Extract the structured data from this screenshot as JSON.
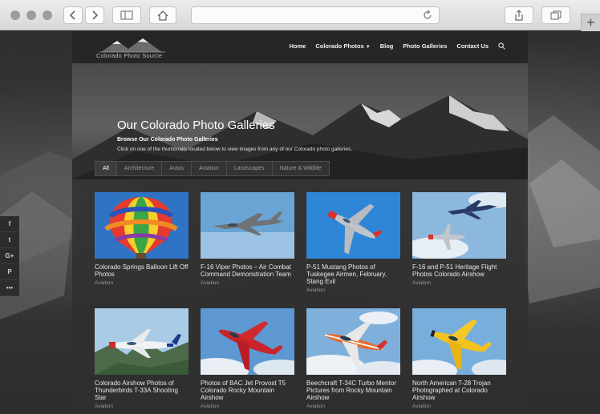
{
  "browser": {
    "back_icon": "chevron-left-icon",
    "forward_icon": "chevron-right-icon",
    "sidebar_icon": "sidebar-icon",
    "home_icon": "home-icon",
    "reload_icon": "reload-icon",
    "share_icon": "share-icon",
    "tabs_icon": "tabs-icon",
    "new_tab_label": "+"
  },
  "site": {
    "logo_text": "Colorado Photo Source",
    "nav": [
      {
        "label": "Home"
      },
      {
        "label": "Colorado Photos",
        "has_caret": true
      },
      {
        "label": "Blog"
      },
      {
        "label": "Photo Galleries"
      },
      {
        "label": "Contact Us"
      }
    ],
    "search_icon": "search-icon"
  },
  "hero": {
    "title": "Our Colorado Photo Galleries",
    "subtitle": "Browse Our Colorado Photo Galleries",
    "description": "Click on one of the thumbnails located below to view images from any of our Colorado photo galleries."
  },
  "filters": [
    "All",
    "Architecture",
    "Autos",
    "Aviation",
    "Landscapes",
    "Nature & Wildlife"
  ],
  "active_filter": "All",
  "galleries": [
    {
      "title": "Colorado Springs Balloon Lift Off Photos",
      "category": "Aviation",
      "image": "balloon"
    },
    {
      "title": "F-16 Viper Photos – Air Combat Command Demonstration Team",
      "category": "Aviation",
      "image": "f16"
    },
    {
      "title": "P-51 Mustang Photos of Tuskegee Airmen, February, Stang Evil",
      "category": "Aviation",
      "image": "p51"
    },
    {
      "title": "F-16 and P-51 Heritage Flight Photos Colorado Airshow",
      "category": "Aviation",
      "image": "heritage"
    },
    {
      "title": "Colorado Airshow Photos of Thunderbirds T-33A Shooting Star",
      "category": "Aviation",
      "image": "t33"
    },
    {
      "title": "Photos of BAC Jet Provost T5 Colorado Rocky Mountain Airshow",
      "category": "Aviation",
      "image": "provost"
    },
    {
      "title": "Beechcraft T-34C Turbo Mentor Pictures from Rocky Mountain Airshow",
      "category": "Aviation",
      "image": "t34"
    },
    {
      "title": "North American T-28 Trojan Photographed at Colorado Airshow",
      "category": "Aviation",
      "image": "t28"
    }
  ],
  "social": [
    "f",
    "t",
    "G+",
    "P",
    "•••"
  ],
  "social_icons": [
    "facebook-icon",
    "twitter-icon",
    "google-plus-icon",
    "pinterest-icon",
    "more-icon"
  ]
}
